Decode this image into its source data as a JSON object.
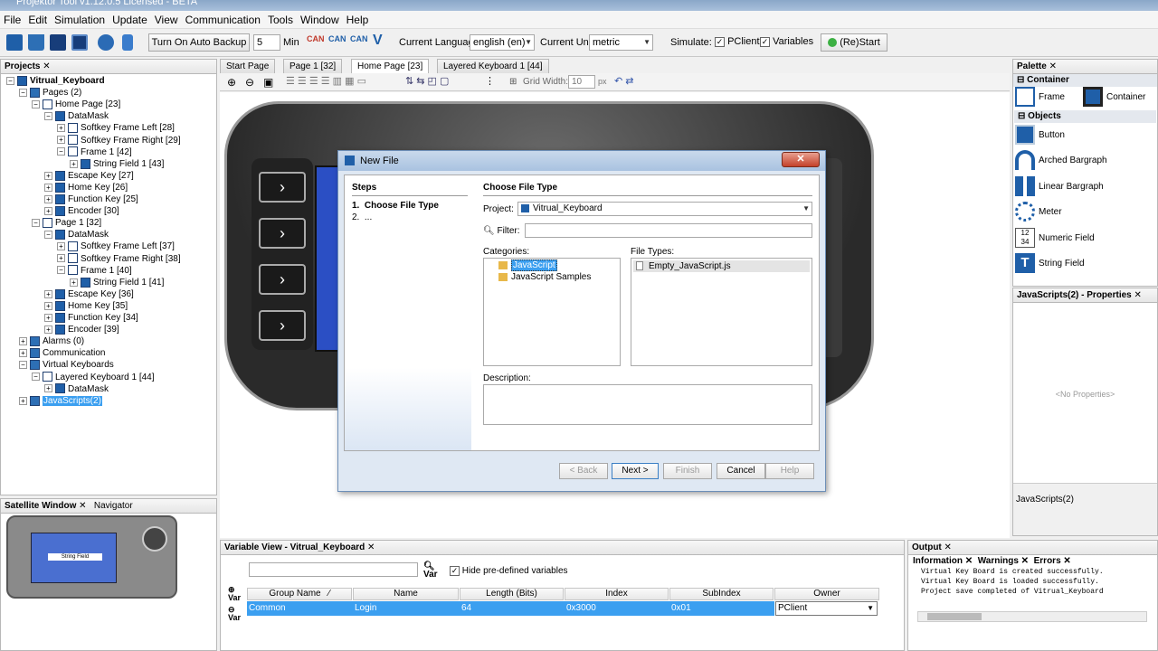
{
  "window": {
    "title": "Projektor Tool v1.12.0.5 Licensed - BETA"
  },
  "menu": [
    "File",
    "Edit",
    "Simulation",
    "Update",
    "View",
    "Communication",
    "Tools",
    "Window",
    "Help"
  ],
  "toolbar": {
    "auto_backup_label": "Turn On Auto Backup",
    "backup_minutes": "5",
    "min_label": "Min",
    "language_label": "Current Language",
    "language_value": "english (en)",
    "unit_label": "Current Unit",
    "unit_value": "metric",
    "simulate_label": "Simulate:",
    "pclient_label": "PClient",
    "variables_label": "Variables",
    "restart_label": "(Re)Start",
    "can_labels": [
      "CAN",
      "CAN",
      "CAN"
    ]
  },
  "projects": {
    "tab": "Projects",
    "tree": [
      {
        "label": "Vitrual_Keyboard",
        "level": 0,
        "bold": true
      },
      {
        "label": "Pages (2)",
        "level": 1
      },
      {
        "label": "Home Page [23]",
        "level": 2
      },
      {
        "label": "DataMask",
        "level": 3
      },
      {
        "label": "Softkey Frame Left [28]",
        "level": 4
      },
      {
        "label": "Softkey Frame Right [29]",
        "level": 4
      },
      {
        "label": "Frame 1 [42]",
        "level": 4
      },
      {
        "label": "String Field 1 [43]",
        "level": 5
      },
      {
        "label": "Escape Key [27]",
        "level": 3
      },
      {
        "label": "Home Key [26]",
        "level": 3
      },
      {
        "label": "Function Key [25]",
        "level": 3
      },
      {
        "label": "Encoder [30]",
        "level": 3
      },
      {
        "label": "Page 1 [32]",
        "level": 2
      },
      {
        "label": "DataMask",
        "level": 3
      },
      {
        "label": "Softkey Frame Left [37]",
        "level": 4
      },
      {
        "label": "Softkey Frame Right [38]",
        "level": 4
      },
      {
        "label": "Frame 1 [40]",
        "level": 4
      },
      {
        "label": "String Field 1 [41]",
        "level": 5
      },
      {
        "label": "Escape Key [36]",
        "level": 3
      },
      {
        "label": "Home Key [35]",
        "level": 3
      },
      {
        "label": "Function Key [34]",
        "level": 3
      },
      {
        "label": "Encoder [39]",
        "level": 3
      },
      {
        "label": "Alarms (0)",
        "level": 1
      },
      {
        "label": "Communication",
        "level": 1
      },
      {
        "label": "Virtual Keyboards",
        "level": 1
      },
      {
        "label": "Layered Keyboard 1 [44]",
        "level": 2
      },
      {
        "label": "DataMask",
        "level": 3
      },
      {
        "label": "JavaScripts(2)",
        "level": 1,
        "selected": true
      }
    ]
  },
  "satellite": {
    "tab1": "Satellite Window",
    "tab2": "Navigator",
    "field_label": "String Field"
  },
  "editor": {
    "tabs": [
      "Start Page",
      "Page 1 [32]",
      "Home Page [23]",
      "Layered Keyboard 1 [44]"
    ],
    "active_tab": 2,
    "grid_width_label": "Grid Width:",
    "grid_width_value": "10",
    "grid_unit": "px"
  },
  "dialog": {
    "title": "New File",
    "steps_title": "Steps",
    "steps": [
      {
        "num": "1.",
        "label": "Choose File Type"
      },
      {
        "num": "2.",
        "label": "..."
      }
    ],
    "heading": "Choose File Type",
    "project_label": "Project:",
    "project_value": "Vitrual_Keyboard",
    "filter_label": "Filter:",
    "categories_label": "Categories:",
    "categories": [
      "JavaScript",
      "JavaScript Samples"
    ],
    "file_types_label": "File Types:",
    "file_types": [
      "Empty_JavaScript.js"
    ],
    "description_label": "Description:",
    "buttons": {
      "back": "< Back",
      "next": "Next >",
      "finish": "Finish",
      "cancel": "Cancel",
      "help": "Help"
    }
  },
  "palette": {
    "tab": "Palette",
    "container_section": "Container",
    "containers": [
      "Frame",
      "Container"
    ],
    "objects_section": "Objects",
    "objects": [
      "Button",
      "Arched Bargraph",
      "Linear Bargraph",
      "Meter",
      "Numeric Field",
      "String Field"
    ]
  },
  "properties": {
    "tab": "JavaScripts(2) - Properties",
    "empty_text": "<No Properties>",
    "footer": "JavaScripts(2)"
  },
  "variable_view": {
    "tab": "Variable View - Vitrual_Keyboard",
    "var_label": "Var",
    "hide_label": "Hide pre-defined variables",
    "columns": [
      "Group Name",
      "Name",
      "Length (Bits)",
      "Index",
      "SubIndex",
      "Owner"
    ],
    "rows": [
      [
        "Common",
        "Login",
        "64",
        "0x3000",
        "0x01",
        "PClient"
      ]
    ]
  },
  "output": {
    "tab": "Output",
    "tabs": [
      "Information",
      "Warnings",
      "Errors"
    ],
    "lines": [
      "Virtual Key Board is created successfully.",
      "Virtual Key Board is loaded successfully.",
      "Project save completed of Vitrual_Keyboard"
    ]
  }
}
